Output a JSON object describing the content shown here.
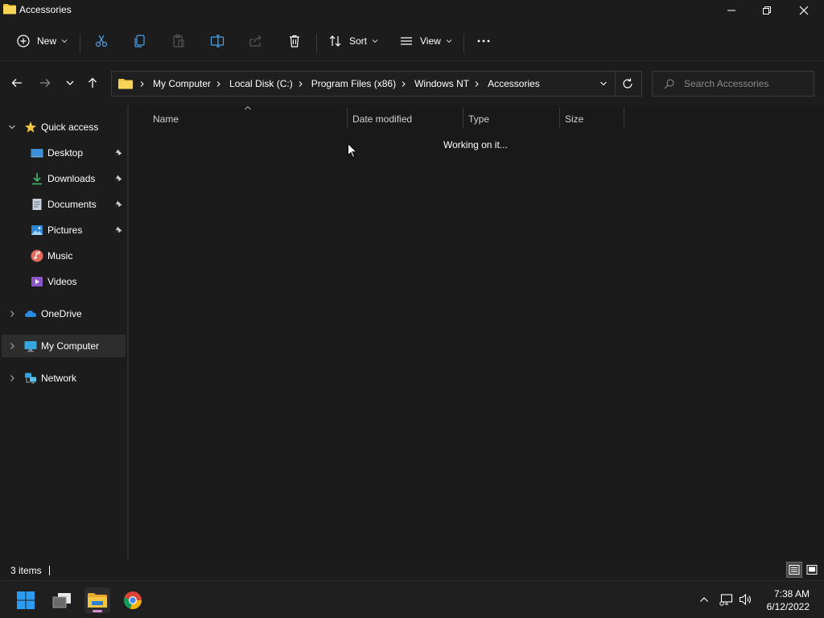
{
  "window": {
    "title": "Accessories"
  },
  "toolbar": {
    "new_label": "New",
    "sort_label": "Sort",
    "view_label": "View"
  },
  "address": {
    "crumbs": [
      "My Computer",
      "Local Disk (C:)",
      "Program Files (x86)",
      "Windows NT",
      "Accessories"
    ]
  },
  "search": {
    "placeholder": "Search Accessories"
  },
  "sidebar": {
    "quick_access": "Quick access",
    "items": [
      {
        "label": "Desktop",
        "icon": "desktop-icon",
        "pinned": true
      },
      {
        "label": "Downloads",
        "icon": "download-icon",
        "pinned": true
      },
      {
        "label": "Documents",
        "icon": "document-icon",
        "pinned": true
      },
      {
        "label": "Pictures",
        "icon": "pictures-icon",
        "pinned": true
      },
      {
        "label": "Music",
        "icon": "music-icon",
        "pinned": false
      },
      {
        "label": "Videos",
        "icon": "videos-icon",
        "pinned": false
      }
    ],
    "onedrive": "OneDrive",
    "my_computer": "My Computer",
    "network": "Network"
  },
  "content": {
    "columns": [
      "Name",
      "Date modified",
      "Type",
      "Size"
    ],
    "status_message": "Working on it..."
  },
  "statusbar": {
    "item_count": "3 items"
  },
  "taskbar": {
    "time": "7:38 AM",
    "date": "6/12/2022"
  },
  "colors": {
    "background": "#1c1c1c",
    "content_bg": "#191919",
    "accent": "#0078d4",
    "folder": "#f4c542"
  }
}
